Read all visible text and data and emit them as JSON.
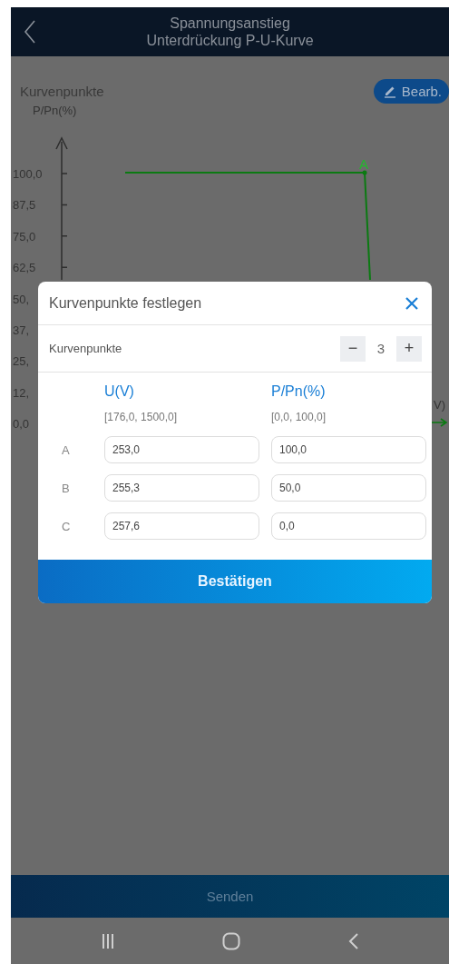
{
  "header": {
    "title_lines": [
      "Spannungsanstieg",
      "Unterdrückung P-U-Kurve"
    ]
  },
  "section": {
    "label": "Kurvenpunkte",
    "edit_button": "Bearb."
  },
  "chart": {
    "y_axis_label": "P/Pn(%)",
    "y_tick_labels": [
      "100,0",
      "87,5",
      "75,0",
      "62,5",
      "50,",
      "37,",
      "25,",
      "12,",
      "0,0"
    ],
    "point_label": "A",
    "x_axis_label": "V)"
  },
  "dialog": {
    "title": "Kurvenpunkte festlegen",
    "count_label": "Kurvenpunkte",
    "minus": "−",
    "count": "3",
    "plus": "+",
    "columns": [
      {
        "header": "U(V)",
        "range": "[176,0, 1500,0]"
      },
      {
        "header": "P/Pn(%)",
        "range": "[0,0, 100,0]"
      }
    ],
    "points": [
      {
        "label": "A",
        "values": [
          "253,0",
          "100,0"
        ]
      },
      {
        "label": "B",
        "values": [
          "255,3",
          "50,0"
        ]
      },
      {
        "label": "C",
        "values": [
          "257,6",
          "0,0"
        ]
      }
    ],
    "confirm": "Bestätigen"
  },
  "send_button": "Senden"
}
